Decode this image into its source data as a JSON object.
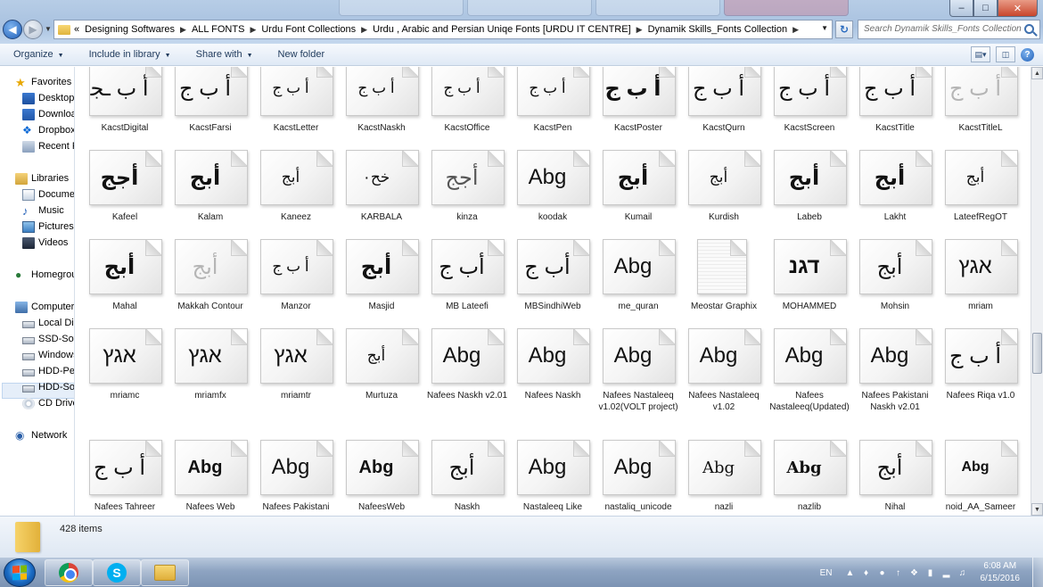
{
  "window": {
    "controls": {
      "minimize": "‒",
      "maximize": "□",
      "close": "✕"
    }
  },
  "address": {
    "prefix": "«",
    "crumbs": [
      "Designing Softwares",
      "ALL FONTS",
      "Urdu Font Collections",
      "Urdu , Arabic and Persian Uniqe Fonts [URDU IT CENTRE]",
      "Dynamik Skills_Fonts Collection"
    ],
    "search_placeholder": "Search Dynamik Skills_Fonts Collection"
  },
  "toolbar": {
    "organize": "Organize",
    "include_in_library": "Include in library",
    "share_with": "Share with",
    "new_folder": "New folder"
  },
  "navpane": {
    "favorites": "Favorites",
    "fav_items": [
      "Desktop",
      "Downloads",
      "Dropbox",
      "Recent Places"
    ],
    "libraries": "Libraries",
    "lib_items": [
      "Documents",
      "Music",
      "Pictures",
      "Videos"
    ],
    "homegroup": "Homegroup",
    "computer": "Computer",
    "comp_items": [
      "Local Disk",
      "SSD-Soft",
      "Windows",
      "HDD-Personal",
      "HDD-Software",
      "CD Drive"
    ],
    "network": "Network"
  },
  "files": [
    {
      "name": "KacstDigital",
      "glyph": "أ ب ـﺠ",
      "style": ""
    },
    {
      "name": "KacstFarsi",
      "glyph": "أ ب ج",
      "style": ""
    },
    {
      "name": "KacstLetter",
      "glyph": "أ ب ج",
      "style": "small"
    },
    {
      "name": "KacstNaskh",
      "glyph": "أ ب ج",
      "style": "small"
    },
    {
      "name": "KacstOffice",
      "glyph": "أ ب ج",
      "style": "small"
    },
    {
      "name": "KacstPen",
      "glyph": "أ ب ج",
      "style": "small"
    },
    {
      "name": "KacstPoster",
      "glyph": "أ ب ج",
      "style": "bold"
    },
    {
      "name": "KacstQurn",
      "glyph": "أ ب ج",
      "style": ""
    },
    {
      "name": "KacstScreen",
      "glyph": "أ ب ج",
      "style": ""
    },
    {
      "name": "KacstTitle",
      "glyph": "أ ب ج",
      "style": ""
    },
    {
      "name": "KacstTitleL",
      "glyph": "أ ب ج",
      "style": "light"
    },
    {
      "name": "Kafeel",
      "glyph": "أجج",
      "style": "bold"
    },
    {
      "name": "Kalam",
      "glyph": "أبج",
      "style": "bold"
    },
    {
      "name": "Kaneez",
      "glyph": "أبج",
      "style": "small"
    },
    {
      "name": "KARBALA",
      "glyph": "خح٠",
      "style": "small"
    },
    {
      "name": "kinza",
      "glyph": "أجج",
      "style": "grey"
    },
    {
      "name": "koodak",
      "glyph": "Abg",
      "style": "latin"
    },
    {
      "name": "Kumail",
      "glyph": "أبج",
      "style": "bold"
    },
    {
      "name": "Kurdish",
      "glyph": "أبج",
      "style": "small"
    },
    {
      "name": "Labeb",
      "glyph": "أبج",
      "style": "bold"
    },
    {
      "name": "Lakht",
      "glyph": "أبج",
      "style": "bold"
    },
    {
      "name": "LateefRegOT",
      "glyph": "أبج",
      "style": "small"
    },
    {
      "name": "Mahal",
      "glyph": "أبج",
      "style": "bold"
    },
    {
      "name": "Makkah Contour",
      "glyph": "أبج",
      "style": "light"
    },
    {
      "name": "Manzor",
      "glyph": "أ ب ج",
      "style": "small"
    },
    {
      "name": "Masjid",
      "glyph": "أبج",
      "style": "bold"
    },
    {
      "name": "MB Lateefi",
      "glyph": "أب ج",
      "style": ""
    },
    {
      "name": "MBSindhiWeb",
      "glyph": "أب ج",
      "style": ""
    },
    {
      "name": "me_quran",
      "glyph": "Abg",
      "style": "latin"
    },
    {
      "name": "Meostar Graphix",
      "glyph": "",
      "style": "blank"
    },
    {
      "name": "MOHAMMED",
      "glyph": "דגנ",
      "style": "bold"
    },
    {
      "name": "Mohsin",
      "glyph": "أبج",
      "style": ""
    },
    {
      "name": "mriam",
      "glyph": "אגץ",
      "style": ""
    },
    {
      "name": "mriamc",
      "glyph": "אגץ",
      "style": ""
    },
    {
      "name": "mriamfx",
      "glyph": "אגץ",
      "style": ""
    },
    {
      "name": "mriamtr",
      "glyph": "אגץ",
      "style": ""
    },
    {
      "name": "Murtuza",
      "glyph": "أبج",
      "style": "small"
    },
    {
      "name": "Nafees Naskh v2.01",
      "glyph": "Abg",
      "style": "latin"
    },
    {
      "name": "Nafees Naskh",
      "glyph": "Abg",
      "style": "latin"
    },
    {
      "name": "Nafees Nastaleeq v1.02(VOLT project)",
      "glyph": "Abg",
      "style": "latin"
    },
    {
      "name": "Nafees Nastaleeq v1.02",
      "glyph": "Abg",
      "style": "latin"
    },
    {
      "name": "Nafees Nastaleeq(Updated)",
      "glyph": "Abg",
      "style": "latin"
    },
    {
      "name": "Nafees Pakistani Naskh v2.01",
      "glyph": "Abg",
      "style": "latin"
    },
    {
      "name": "Nafees Riqa v1.0",
      "glyph": "أ ب ج",
      "style": ""
    },
    {
      "name": "Nafees Tahreer",
      "glyph": "أ ب ج",
      "style": ""
    },
    {
      "name": "Nafees Web",
      "glyph": "Abg",
      "style": "latin-bold"
    },
    {
      "name": "Nafees Pakistani",
      "glyph": "Abg",
      "style": "latin"
    },
    {
      "name": "NafeesWeb",
      "glyph": "Abg",
      "style": "latin-bold"
    },
    {
      "name": "Naskh",
      "glyph": "أبج",
      "style": ""
    },
    {
      "name": "Nastaleeq Like",
      "glyph": "Abg",
      "style": "latin"
    },
    {
      "name": "nastaliq_unicode",
      "glyph": "Abg",
      "style": "latin"
    },
    {
      "name": "nazli",
      "glyph": "Abg",
      "style": "serif"
    },
    {
      "name": "nazlib",
      "glyph": "Abg",
      "style": "serif-bold"
    },
    {
      "name": "Nihal",
      "glyph": "أبج",
      "style": ""
    },
    {
      "name": "noid_AA_Sameer",
      "glyph": "Abg",
      "style": "latin-small"
    }
  ],
  "details": {
    "count": "428 items"
  },
  "taskbar": {
    "lang": "EN",
    "time": "6:08 AM",
    "date": "6/15/2016"
  }
}
